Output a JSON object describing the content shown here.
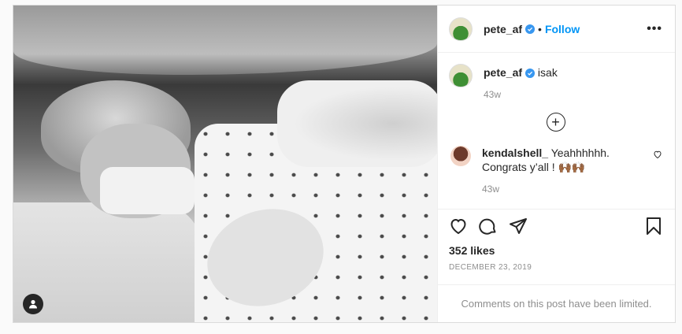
{
  "post": {
    "username": "pete_af",
    "separator": "•",
    "follow_label": "Follow",
    "more_label": "•••",
    "caption": {
      "username": "pete_af",
      "text": "isak",
      "time": "43w"
    },
    "load_more": "+",
    "comments": [
      {
        "username": "kendalshell_",
        "text": "Yeahhhhhh. Congrats y’all ! 🙌🏾🙌🏾",
        "time": "43w"
      }
    ],
    "likes": "352 likes",
    "date": "DECEMBER 23, 2019",
    "comments_limited": "Comments on this post have been limited."
  },
  "icons": {
    "verified": "verified-badge-icon",
    "like": "heart-icon",
    "comment": "comment-icon",
    "share": "paper-plane-icon",
    "save": "bookmark-icon",
    "user_tag": "user-tag-icon"
  },
  "colors": {
    "accent": "#0095f6",
    "verified": "#3897f0",
    "text": "#262626",
    "muted": "#8e8e8e",
    "border": "#dbdbdb"
  }
}
